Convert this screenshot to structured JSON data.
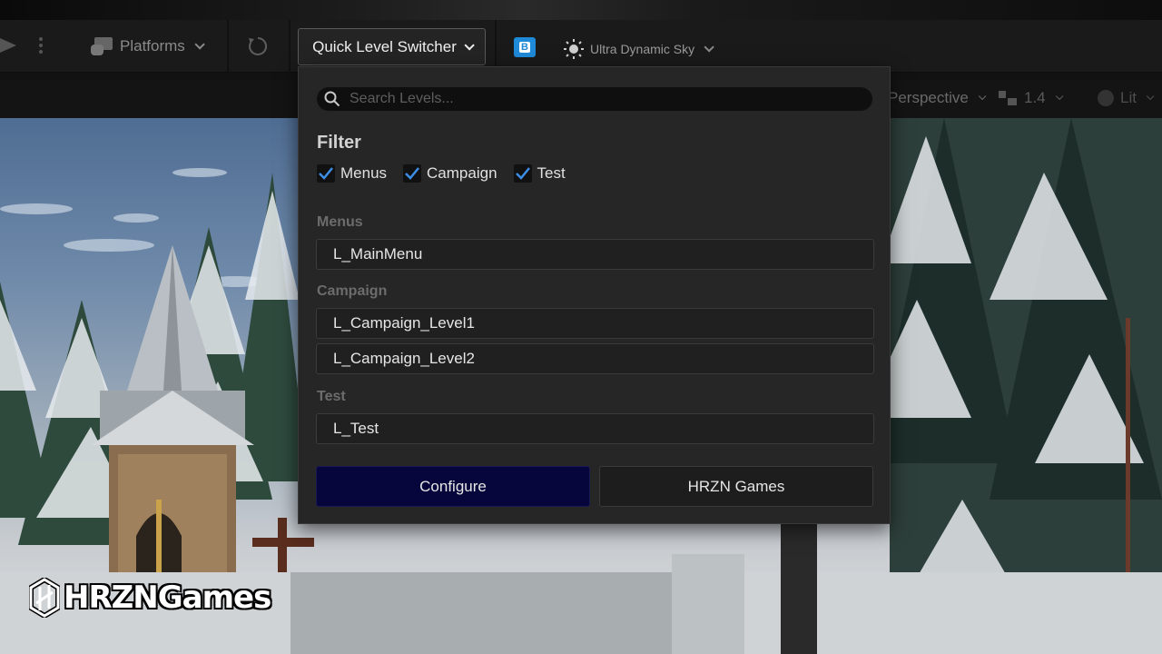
{
  "toolbar": {
    "platforms_label": "Platforms",
    "quick_level_switcher_label": "Quick Level Switcher",
    "blueprint_badge": "B",
    "sky_label": "Ultra Dynamic Sky"
  },
  "viewport_toolbar": {
    "perspective_label": "Perspective",
    "camera_speed": "1.4",
    "view_mode_label": "Lit"
  },
  "popup": {
    "search_placeholder": "Search Levels...",
    "filter_title": "Filter",
    "filters": [
      {
        "label": "Menus",
        "checked": true
      },
      {
        "label": "Campaign",
        "checked": true
      },
      {
        "label": "Test",
        "checked": true
      }
    ],
    "sections": [
      {
        "title": "Menus",
        "levels": [
          "L_MainMenu"
        ]
      },
      {
        "title": "Campaign",
        "levels": [
          "L_Campaign_Level1",
          "L_Campaign_Level2"
        ]
      },
      {
        "title": "Test",
        "levels": [
          "L_Test"
        ]
      }
    ],
    "configure_label": "Configure",
    "hrzn_label": "HRZN Games"
  },
  "watermark": {
    "text": "HRZNGames"
  },
  "colors": {
    "checkbox_accent": "#3d8ee6",
    "configure_bg": "#06063c",
    "badge_blue": "#1f8ad8"
  },
  "icons": [
    "play-icon",
    "more-icon",
    "platforms-icon",
    "reload-icon",
    "blueprint-icon",
    "sun-icon",
    "search-icon",
    "camera-speed-icon",
    "lit-icon"
  ]
}
